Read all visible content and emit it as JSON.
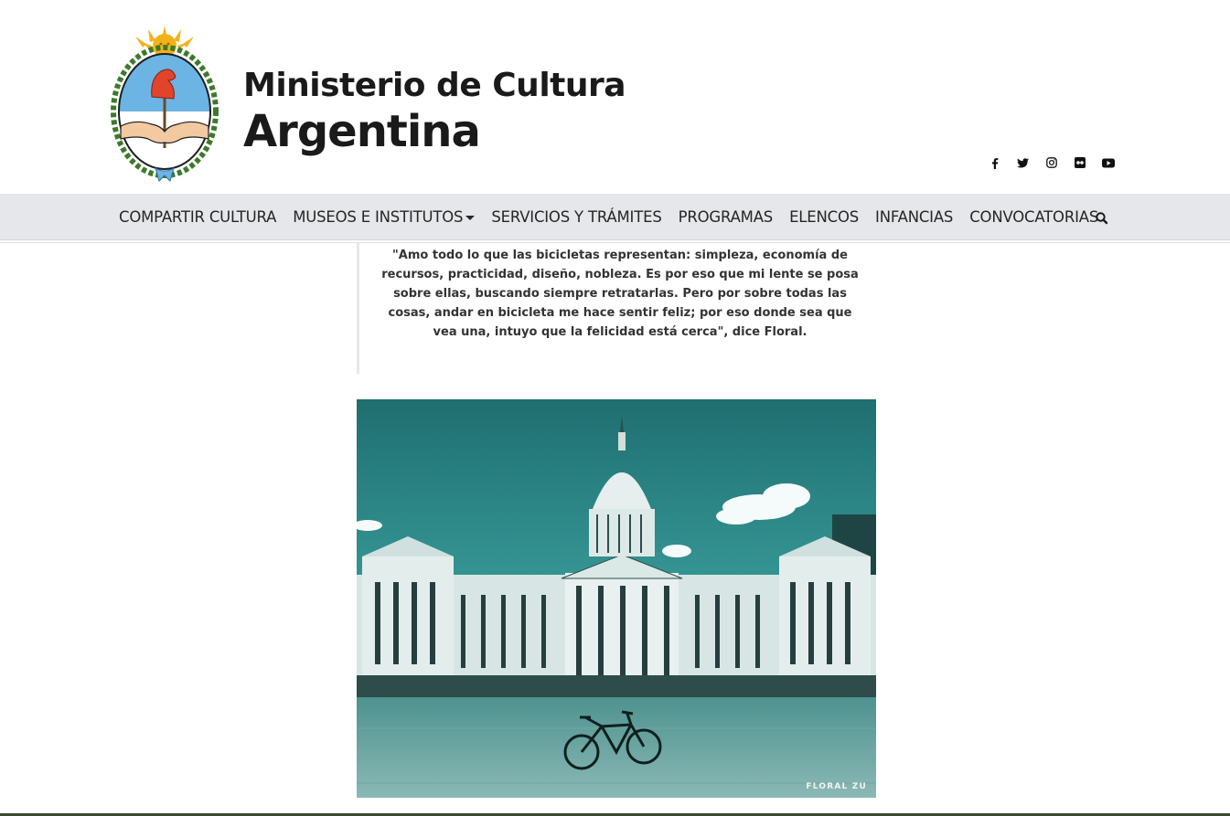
{
  "header": {
    "brand_line1": "Ministerio de Cultura",
    "brand_line2": "Argentina"
  },
  "social": [
    {
      "name": "facebook-icon"
    },
    {
      "name": "twitter-icon"
    },
    {
      "name": "instagram-icon"
    },
    {
      "name": "flickr-icon"
    },
    {
      "name": "youtube-icon"
    }
  ],
  "nav": {
    "items": [
      {
        "label": "COMPARTIR CULTURA"
      },
      {
        "label": "MUSEOS E INSTITUTOS",
        "has_dropdown": true
      },
      {
        "label": "SERVICIOS Y TRÁMITES"
      },
      {
        "label": "PROGRAMAS"
      },
      {
        "label": "ELENCOS"
      },
      {
        "label": "INFANCIAS"
      },
      {
        "label": "CONVOCATORIAS"
      }
    ]
  },
  "article": {
    "quote": "\"Amo todo lo que las bicicletas representan: simpleza, economía de recursos, practicidad, diseño, nobleza. Es por eso que mi lente se posa sobre ellas, buscando siempre retratarlas. Pero por sobre todas las cosas, andar en bicicleta me hace sentir feliz; por eso donde sea que vea una, intuyo que la felicidad está cerca\", dice Floral.",
    "photo_credit": "FLORAL ZU"
  },
  "colors": {
    "nav_bg": "#e6e7ea",
    "photo_sky": "#2f8c8c",
    "photo_ground": "#5a9e9c",
    "flag_blue": "#6cb4e4",
    "sun_gold": "#f2b21a",
    "cap_red": "#e0442a",
    "laurel_green": "#3c7a2a"
  }
}
